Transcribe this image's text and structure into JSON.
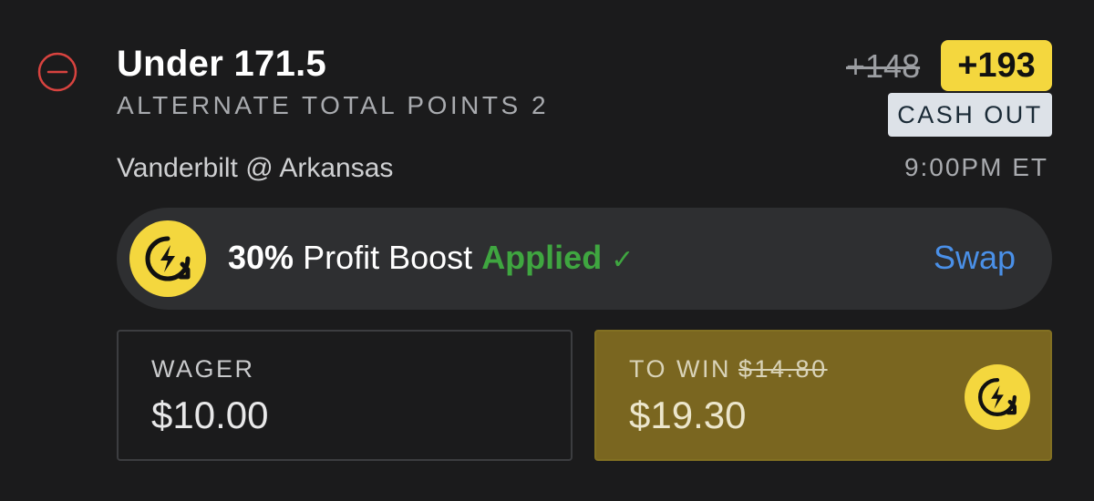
{
  "bet": {
    "selection": "Under 171.5",
    "market": "ALTERNATE TOTAL POINTS 2",
    "matchup": "Vanderbilt @ Arkansas",
    "odds_original": "+148",
    "odds_boosted": "+193",
    "cash_out_label": "CASH OUT",
    "time": "9:00PM ET"
  },
  "boost": {
    "percent": "30%",
    "label": "Profit Boost",
    "status": "Applied",
    "check": "✓",
    "swap_label": "Swap",
    "icon": "lightning-boost-icon"
  },
  "wager": {
    "label": "WAGER",
    "amount": "$10.00"
  },
  "to_win": {
    "label": "TO WIN",
    "original": "$14.80",
    "amount": "$19.30"
  },
  "colors": {
    "background": "#1b1b1c",
    "remove_red": "#d8433f",
    "boost_yellow": "#f4d73e",
    "applied_green": "#3fa640",
    "swap_blue": "#4a90e8",
    "to_win_bg": "#7a6620"
  }
}
